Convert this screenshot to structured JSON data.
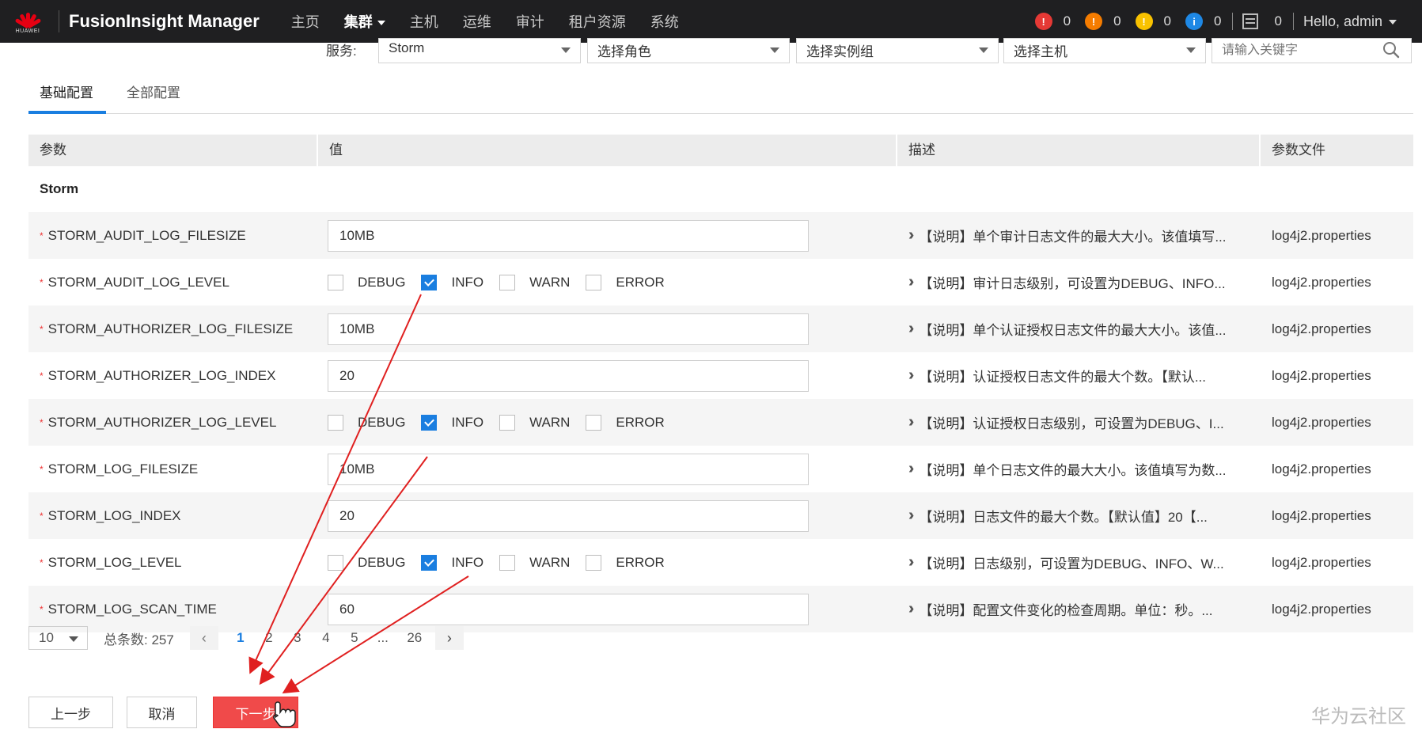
{
  "app": {
    "logo_text": "HUAWEI",
    "title": "FusionInsight Manager",
    "nav": [
      {
        "label": "主页",
        "active": false
      },
      {
        "label": "集群",
        "active": true
      },
      {
        "label": "主机",
        "active": false
      },
      {
        "label": "运维",
        "active": false
      },
      {
        "label": "审计",
        "active": false
      },
      {
        "label": "租户资源",
        "active": false
      },
      {
        "label": "系统",
        "active": false
      }
    ],
    "alarms": [
      {
        "name": "critical-alarm",
        "count": "0",
        "color": "#e53935",
        "glyph": "!"
      },
      {
        "name": "major-alarm",
        "count": "0",
        "color": "#f57c00",
        "glyph": "!"
      },
      {
        "name": "minor-alarm",
        "count": "0",
        "color": "#f9c200",
        "glyph": "!"
      },
      {
        "name": "info-alarm",
        "count": "0",
        "color": "#1e88e5",
        "glyph": "i"
      }
    ],
    "tasks_count": "0",
    "user_greeting": "Hello, admin"
  },
  "filters": {
    "service_label": "服务:",
    "service_value": "Storm",
    "role_placeholder": "选择角色",
    "instance_group_placeholder": "选择实例组",
    "host_placeholder": "选择主机",
    "search_placeholder": "请输入关键字"
  },
  "tabs": [
    {
      "label": "基础配置",
      "active": true
    },
    {
      "label": "全部配置",
      "active": false
    }
  ],
  "table": {
    "headers": [
      "参数",
      "值",
      "描述",
      "参数文件"
    ],
    "group": "Storm",
    "rows": [
      {
        "param": "STORM_AUDIT_LOG_FILESIZE",
        "type": "input",
        "value": "10MB",
        "desc": "【说明】单个审计日志文件的最大大小。该值填写...",
        "file": "log4j2.properties"
      },
      {
        "param": "STORM_AUDIT_LOG_LEVEL",
        "type": "checks",
        "checked": "INFO",
        "desc": "【说明】审计日志级别，可设置为DEBUG、INFO...",
        "file": "log4j2.properties"
      },
      {
        "param": "STORM_AUTHORIZER_LOG_FILESIZE",
        "type": "input",
        "value": "10MB",
        "desc": "【说明】单个认证授权日志文件的最大大小。该值...",
        "file": "log4j2.properties"
      },
      {
        "param": "STORM_AUTHORIZER_LOG_INDEX",
        "type": "input",
        "value": "20",
        "desc": "【说明】认证授权日志文件的最大个数。【默认...",
        "file": "log4j2.properties"
      },
      {
        "param": "STORM_AUTHORIZER_LOG_LEVEL",
        "type": "checks",
        "checked": "INFO",
        "desc": "【说明】认证授权日志级别，可设置为DEBUG、I...",
        "file": "log4j2.properties"
      },
      {
        "param": "STORM_LOG_FILESIZE",
        "type": "input",
        "value": "10MB",
        "desc": "【说明】单个日志文件的最大大小。该值填写为数...",
        "file": "log4j2.properties"
      },
      {
        "param": "STORM_LOG_INDEX",
        "type": "input",
        "value": "20",
        "desc": "【说明】日志文件的最大个数。【默认值】20【...",
        "file": "log4j2.properties"
      },
      {
        "param": "STORM_LOG_LEVEL",
        "type": "checks",
        "checked": "INFO",
        "desc": "【说明】日志级别，可设置为DEBUG、INFO、W...",
        "file": "log4j2.properties"
      },
      {
        "param": "STORM_LOG_SCAN_TIME",
        "type": "input",
        "value": "60",
        "desc": "【说明】配置文件变化的检查周期。单位：秒。...",
        "file": "log4j2.properties"
      }
    ],
    "levels": [
      "DEBUG",
      "INFO",
      "WARN",
      "ERROR"
    ]
  },
  "pagination": {
    "page_size": "10",
    "total": "总条数: 257",
    "pages": [
      "1",
      "2",
      "3",
      "4",
      "5",
      "...",
      "26"
    ],
    "current": "1"
  },
  "buttons": {
    "prev": "上一步",
    "cancel": "取消",
    "next": "下一步"
  },
  "watermark": "华为云社区",
  "annotation_color": "#e02020"
}
